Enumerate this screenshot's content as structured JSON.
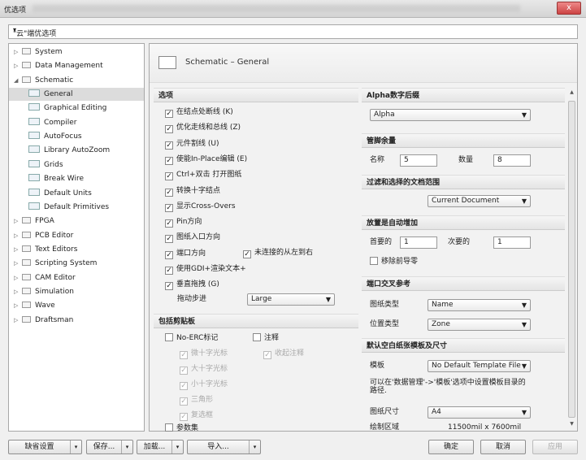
{
  "window": {
    "title": "优选项",
    "close": "x"
  },
  "path": {
    "value": "\"云\"端优选项"
  },
  "tree": {
    "items": [
      {
        "label": "System",
        "arrow": "▷"
      },
      {
        "label": "Data Management",
        "arrow": "▷"
      },
      {
        "label": "Schematic",
        "arrow": "◢"
      },
      {
        "label": "General"
      },
      {
        "label": "Graphical Editing"
      },
      {
        "label": "Compiler"
      },
      {
        "label": "AutoFocus"
      },
      {
        "label": "Library AutoZoom"
      },
      {
        "label": "Grids"
      },
      {
        "label": "Break Wire"
      },
      {
        "label": "Default Units"
      },
      {
        "label": "Default Primitives"
      },
      {
        "label": "FPGA",
        "arrow": "▷"
      },
      {
        "label": "PCB Editor",
        "arrow": "▷"
      },
      {
        "label": "Text Editors",
        "arrow": "▷"
      },
      {
        "label": "Scripting System",
        "arrow": "▷"
      },
      {
        "label": "CAM Editor",
        "arrow": "▷"
      },
      {
        "label": "Simulation",
        "arrow": "▷"
      },
      {
        "label": "Wave",
        "arrow": "▷"
      },
      {
        "label": "Draftsman",
        "arrow": "▷"
      }
    ]
  },
  "header": {
    "title": "Schematic – General"
  },
  "options": {
    "section": "选项",
    "items": [
      {
        "label": "在结点处断线 (K)",
        "checked": "✓"
      },
      {
        "label": "优化走线和总线 (Z)",
        "checked": "✓"
      },
      {
        "label": "元件割线 (U)",
        "checked": "✓"
      },
      {
        "label": "使能In-Place编辑 (E)",
        "checked": "✓"
      },
      {
        "label": "Ctrl+双击 打开图纸",
        "checked": "✓"
      },
      {
        "label": "转换十字结点",
        "checked": "✓"
      },
      {
        "label": "显示Cross-Overs",
        "checked": "✓"
      },
      {
        "label": "Pin方向",
        "checked": "✓"
      },
      {
        "label": "图纸入口方向",
        "checked": "✓"
      },
      {
        "label": "端口方向",
        "checked": "✓"
      },
      {
        "label": "使用GDI+渲染文本+",
        "checked": "✓"
      },
      {
        "label": "垂直拖拽 (G)",
        "checked": "✓"
      }
    ],
    "unconnected_label": "未连接的从左到右",
    "unconnected_checked": "✓",
    "drag_step_label": "拖动步进",
    "drag_step_value": "Large"
  },
  "clipboard": {
    "section": "包括剪贴板",
    "no_erc": "No-ERC标记",
    "note": "注释",
    "crosshair_small": "微十字光标",
    "crosshair_large": "大十字光标",
    "crosshair_tiny": "小十字光标",
    "triangle": "三角形",
    "checkbox": "复选框",
    "collapse_note": "收起注释",
    "params": "参数集",
    "checked": "✓"
  },
  "alpha": {
    "section": "Alpha数字后缀",
    "value": "Alpha"
  },
  "pin_margin": {
    "section": "管脚余量",
    "name_label": "名称",
    "name_value": "5",
    "number_label": "数量",
    "number_value": "8"
  },
  "filter": {
    "section": "过滤和选择的文档范围",
    "value": "Current Document"
  },
  "auto_inc": {
    "section": "放置是自动增加",
    "primary_label": "首要的",
    "primary_value": "1",
    "secondary_label": "次要的",
    "secondary_value": "1",
    "remove_label": "移除前导零"
  },
  "port_ref": {
    "section": "端口交叉参考",
    "sheet_type_label": "图纸类型",
    "sheet_type_value": "Name",
    "location_label": "位置类型",
    "location_value": "Zone"
  },
  "template": {
    "section": "默认空白纸张模板及尺寸",
    "template_label": "模板",
    "template_value": "No Default Template File",
    "hint": "可以在'数据管理'->'模板'选项中设置模板目录的路径.",
    "size_label": "图纸尺寸",
    "size_value": "A4",
    "area_label": "绘制区域",
    "area_value": "11500mil x 7600mil"
  },
  "buttons": {
    "defaults": "缺省设置",
    "save": "保存...",
    "load": "加载...",
    "import": "导入...",
    "ok": "确定",
    "cancel": "取消",
    "apply": "应用"
  }
}
